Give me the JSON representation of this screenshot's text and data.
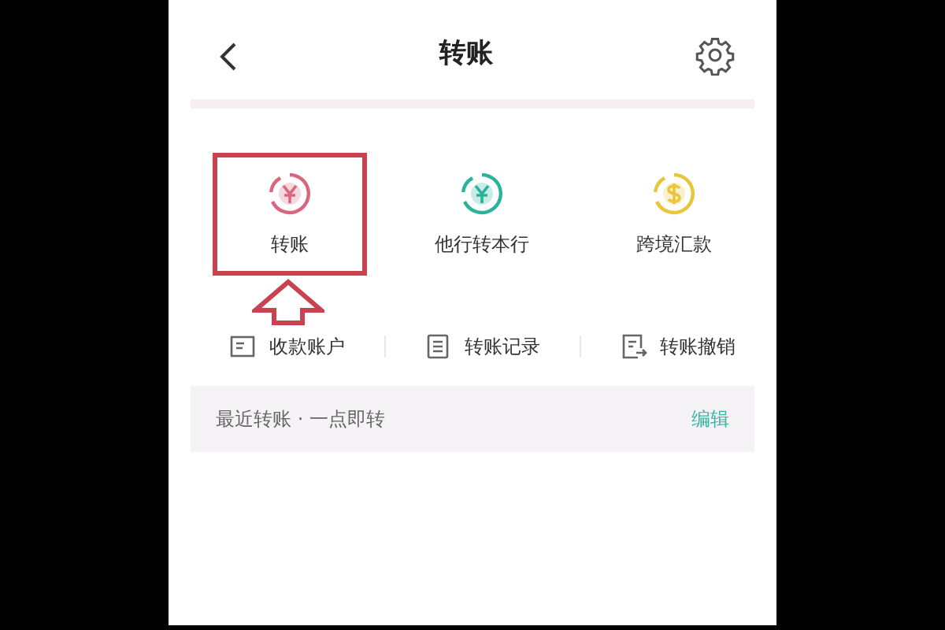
{
  "header": {
    "title": "转账"
  },
  "services": [
    {
      "label": "转账",
      "color": "#d9657f",
      "highlighted": true
    },
    {
      "label": "他行转本行",
      "color": "#2bb39a",
      "highlighted": false
    },
    {
      "label": "跨境汇款",
      "color": "#e8c53a",
      "highlighted": false
    }
  ],
  "links": [
    {
      "label": "收款账户"
    },
    {
      "label": "转账记录"
    },
    {
      "label": "转账撤销"
    }
  ],
  "recent": {
    "text": "最近转账 · 一点即转",
    "action": "编辑"
  }
}
